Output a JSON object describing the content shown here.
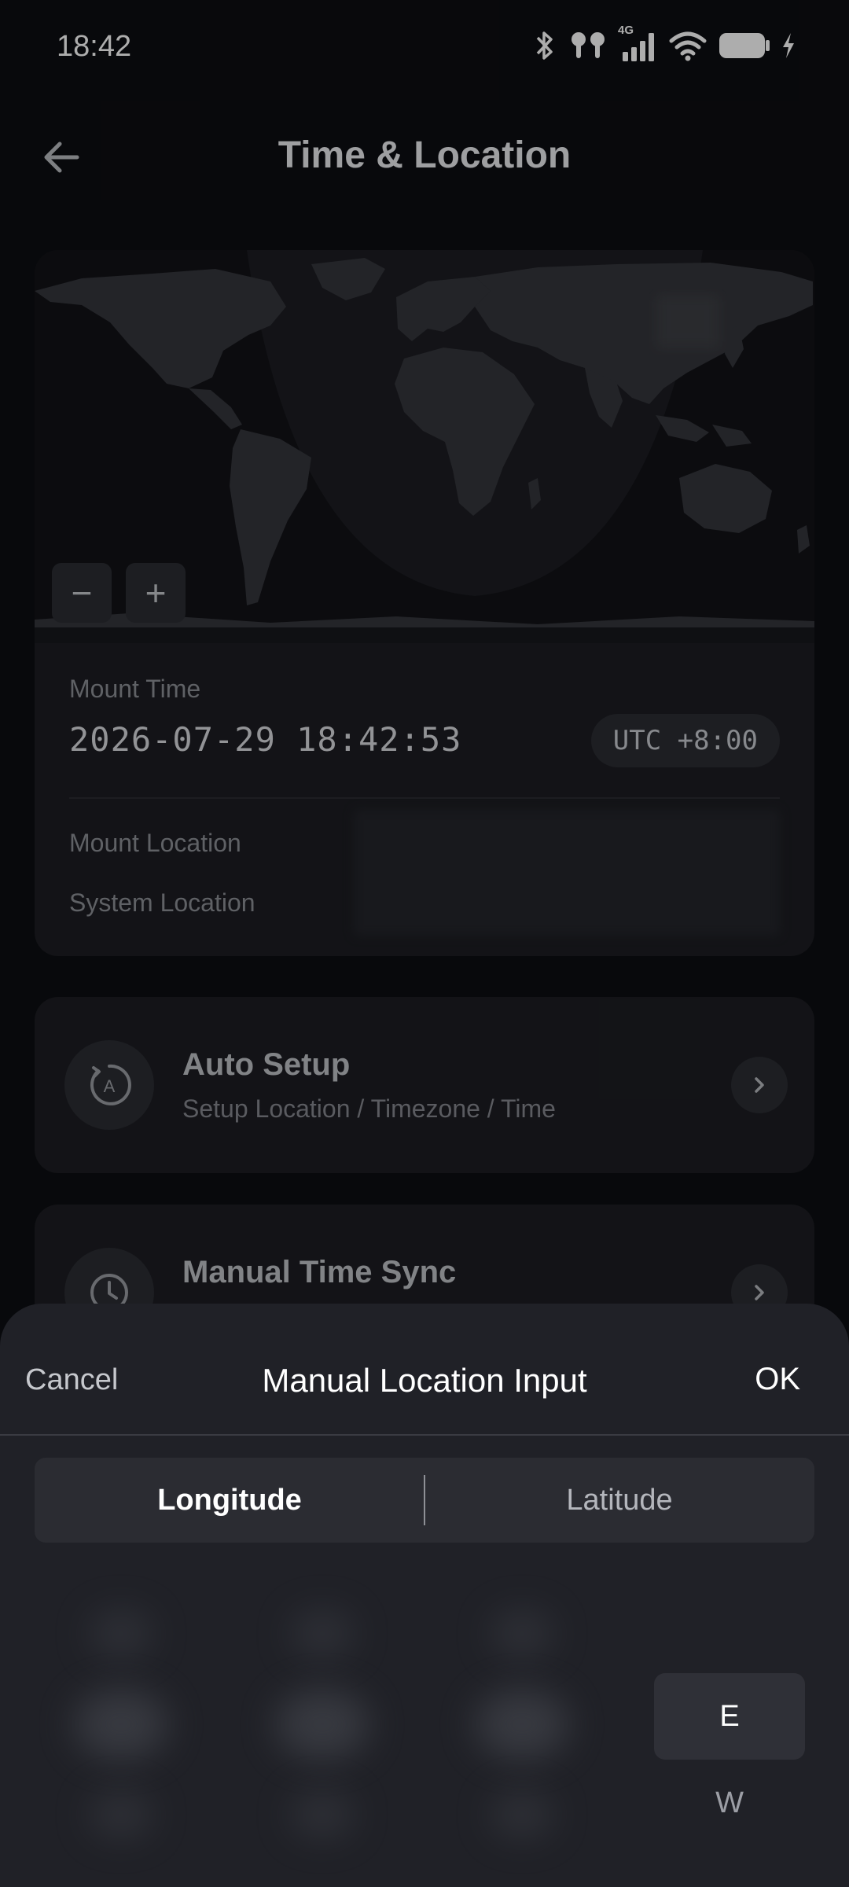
{
  "status_bar": {
    "time": "18:42",
    "network_label": "4G",
    "icons": [
      "bluetooth-icon",
      "earbuds-icon",
      "cellular-signal-icon",
      "wifi-icon",
      "battery-icon",
      "charging-icon"
    ]
  },
  "header": {
    "title": "Time & Location",
    "back_icon": "arrow-left-icon"
  },
  "map_card": {
    "zoom_out_label": "−",
    "zoom_in_label": "+",
    "mount_time_label": "Mount Time",
    "mount_time_value": "2026-07-29 18:42:53",
    "timezone_badge": "UTC +8:00",
    "mount_location_label": "Mount Location",
    "system_location_label": "System Location"
  },
  "actions": {
    "auto_setup": {
      "title": "Auto Setup",
      "subtitle": "Setup Location / Timezone / Time",
      "icon": "auto-setup-icon"
    },
    "manual_time_sync": {
      "title": "Manual Time Sync",
      "icon": "clock-icon"
    }
  },
  "sheet": {
    "cancel_label": "Cancel",
    "title": "Manual Location Input",
    "ok_label": "OK",
    "tabs": {
      "longitude": "Longitude",
      "latitude": "Latitude"
    },
    "selected_tab": "Longitude",
    "directions": {
      "east": "E",
      "west": "W"
    },
    "selected_direction": "E"
  },
  "colors": {
    "background": "#0d0e12",
    "card": "#1c1d22",
    "sheet": "#202127",
    "control": "#2b2d33"
  }
}
